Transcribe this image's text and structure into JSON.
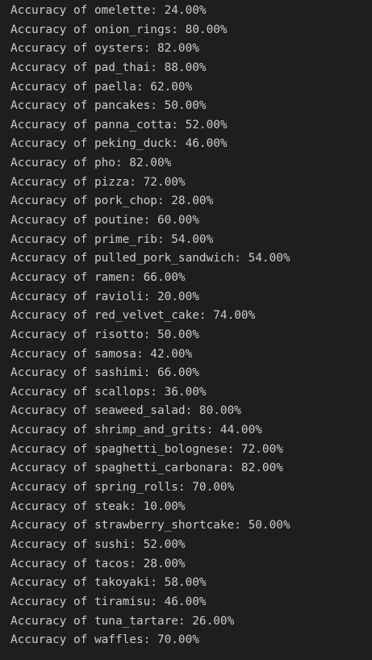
{
  "terminal": {
    "lines": [
      "Accuracy of omelette: 24.00%",
      "Accuracy of onion_rings: 80.00%",
      "Accuracy of oysters: 82.00%",
      "Accuracy of pad_thai: 88.00%",
      "Accuracy of paella: 62.00%",
      "Accuracy of pancakes: 50.00%",
      "Accuracy of panna_cotta: 52.00%",
      "Accuracy of peking_duck: 46.00%",
      "Accuracy of pho: 82.00%",
      "Accuracy of pizza: 72.00%",
      "Accuracy of pork_chop: 28.00%",
      "Accuracy of poutine: 60.00%",
      "Accuracy of prime_rib: 54.00%",
      "Accuracy of pulled_pork_sandwich: 54.00%",
      "Accuracy of ramen: 66.00%",
      "Accuracy of ravioli: 20.00%",
      "Accuracy of red_velvet_cake: 74.00%",
      "Accuracy of risotto: 50.00%",
      "Accuracy of samosa: 42.00%",
      "Accuracy of sashimi: 66.00%",
      "Accuracy of scallops: 36.00%",
      "Accuracy of seaweed_salad: 80.00%",
      "Accuracy of shrimp_and_grits: 44.00%",
      "Accuracy of spaghetti_bolognese: 72.00%",
      "Accuracy of spaghetti_carbonara: 82.00%",
      "Accuracy of spring_rolls: 70.00%",
      "Accuracy of steak: 10.00%",
      "Accuracy of strawberry_shortcake: 50.00%",
      "Accuracy of sushi: 52.00%",
      "Accuracy of tacos: 28.00%",
      "Accuracy of takoyaki: 58.00%",
      "Accuracy of tiramisu: 46.00%",
      "Accuracy of tuna_tartare: 26.00%",
      "Accuracy of waffles: 70.00%"
    ]
  }
}
